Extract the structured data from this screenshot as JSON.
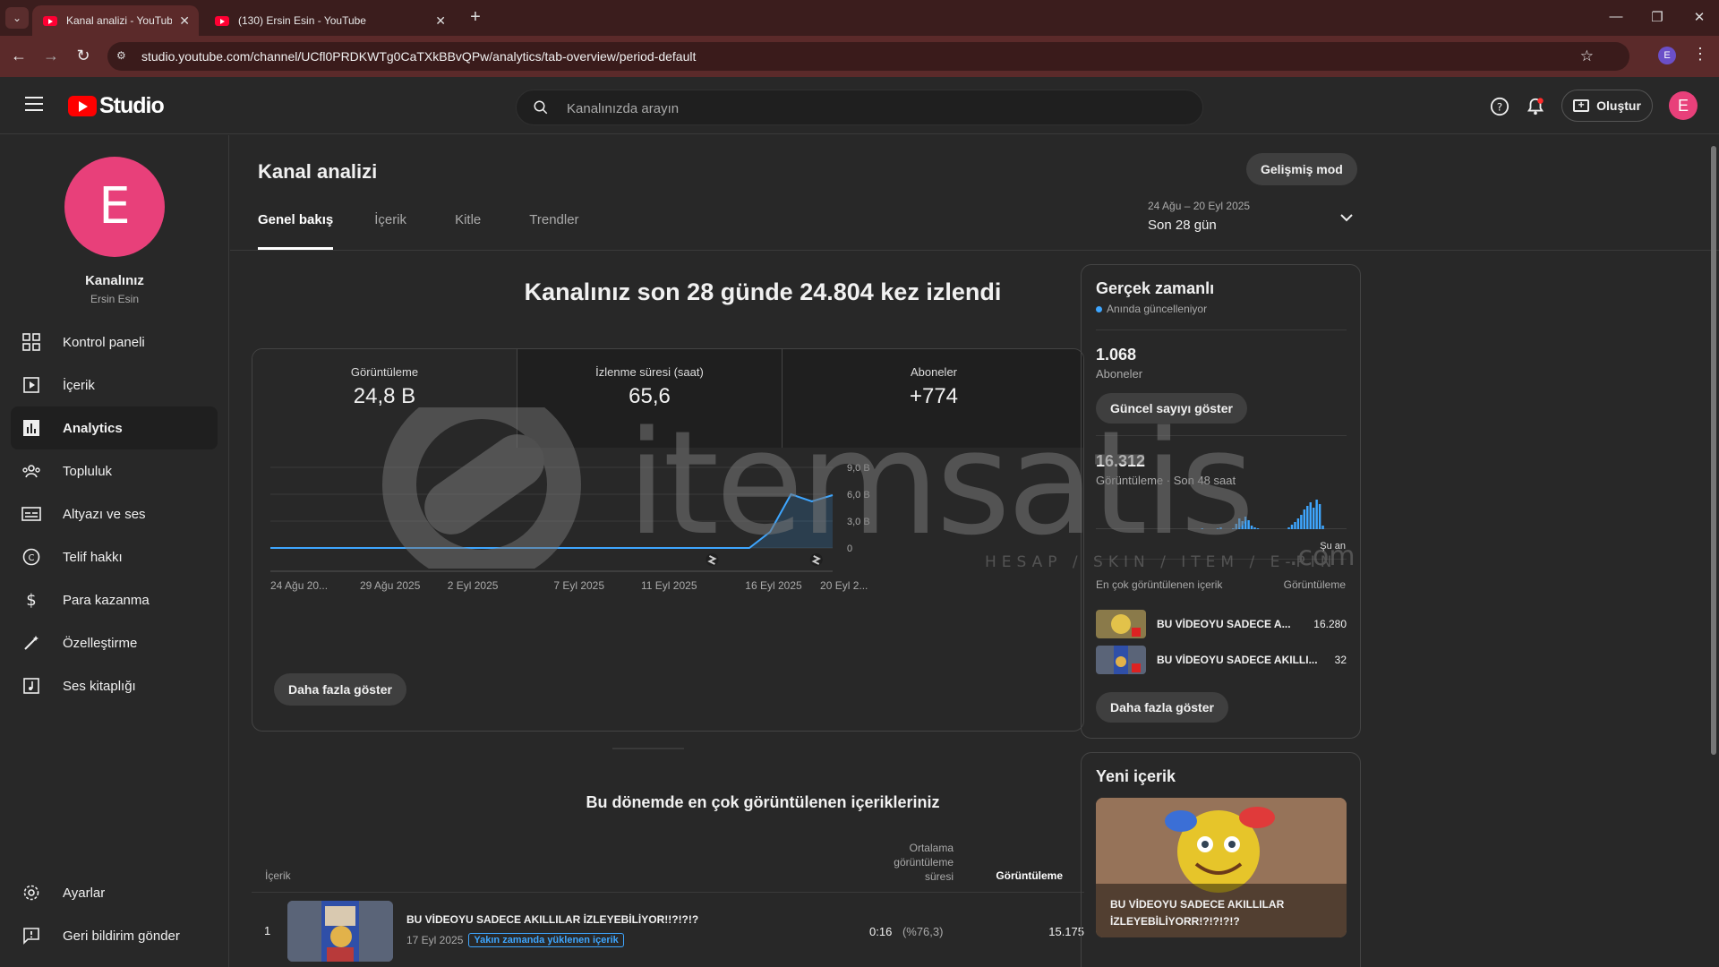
{
  "browser": {
    "tabs": [
      {
        "title": "Kanal analizi - YouTube Studio",
        "active": true
      },
      {
        "title": "(130) Ersin Esin - YouTube",
        "active": false
      }
    ],
    "url": "studio.youtube.com/channel/UCfl0PRDKWTg0CaTXkBBvQPw/analytics/tab-overview/period-default",
    "profile_initial": "E"
  },
  "header": {
    "logo_text": "Studio",
    "search_placeholder": "Kanalınızda arayın",
    "create_label": "Oluştur",
    "avatar_initial": "E"
  },
  "sidebar": {
    "avatar_initial": "E",
    "channel_label": "Kanalınız",
    "channel_name": "Ersin Esin",
    "items": [
      {
        "label": "Kontrol paneli",
        "icon": "dashboard-icon"
      },
      {
        "label": "İçerik",
        "icon": "content-icon"
      },
      {
        "label": "Analytics",
        "icon": "analytics-icon",
        "active": true
      },
      {
        "label": "Topluluk",
        "icon": "community-icon"
      },
      {
        "label": "Altyazı ve ses",
        "icon": "subtitles-icon"
      },
      {
        "label": "Telif hakkı",
        "icon": "copyright-icon"
      },
      {
        "label": "Para kazanma",
        "icon": "monetization-icon"
      },
      {
        "label": "Özelleştirme",
        "icon": "customization-icon"
      },
      {
        "label": "Ses kitaplığı",
        "icon": "audio-library-icon"
      }
    ],
    "bottom": [
      {
        "label": "Ayarlar",
        "icon": "settings-icon"
      },
      {
        "label": "Geri bildirim gönder",
        "icon": "feedback-icon"
      }
    ]
  },
  "main": {
    "title": "Kanal analizi",
    "advanced_mode": "Gelişmiş mod",
    "tabs": [
      "Genel bakış",
      "İçerik",
      "Kitle",
      "Trendler"
    ],
    "period_range": "24 Ağu – 20 Eyl 2025",
    "period_label": "Son 28 gün",
    "headline": "Kanalınız son 28 günde 24.804 kez izlendi",
    "metrics": [
      {
        "label": "Görüntüleme",
        "value": "24,8 B"
      },
      {
        "label": "İzlenme süresi (saat)",
        "value": "65,6"
      },
      {
        "label": "Aboneler",
        "value": "+774"
      }
    ],
    "show_more": "Daha fazla göster",
    "top_content_title": "Bu dönemde en çok görüntülenen içerikleriniz",
    "table": {
      "col_content": "İçerik",
      "col_avg_line1": "Ortalama",
      "col_avg_line2": "görüntüleme",
      "col_avg_line3": "süresi",
      "col_views": "Görüntüleme",
      "rows": [
        {
          "rank": "1",
          "title": "BU VİDEOYU SADECE AKILLILAR İZLEYEBİLİYOR!!?!?!?",
          "date": "17 Eyl 2025",
          "badge": "Yakın zamanda yüklenen içerik",
          "avg": "0:16",
          "avg_pct": "(%76,3)",
          "views": "15.175"
        }
      ]
    }
  },
  "chart_data": {
    "type": "area",
    "x_tick_labels": [
      "24 Ağu 20...",
      "29 Ağu 2025",
      "2 Eyl 2025",
      "7 Eyl 2025",
      "11 Eyl 2025",
      "16 Eyl 2025",
      "20 Eyl 2..."
    ],
    "y_tick_labels": [
      "0",
      "3,0 B",
      "6,0 B",
      "9,0 B"
    ],
    "ylim": [
      0,
      9000
    ],
    "series": [
      {
        "values": [
          0,
          0,
          0,
          0,
          0,
          0,
          0,
          0,
          0,
          0,
          0,
          0,
          0,
          0,
          0,
          0,
          0,
          0,
          0,
          0,
          0,
          0,
          0,
          0,
          1800,
          6000,
          5200,
          5900
        ]
      }
    ],
    "color": "#3ea6ff"
  },
  "realtime": {
    "title": "Gerçek zamanlı",
    "subtitle": "Anında güncelleniyor",
    "subs_value": "1.068",
    "subs_label": "Aboneler",
    "live_count_btn": "Güncel sayıyı göster",
    "views_value": "16.312",
    "views_label": "Görüntüleme · Son 48 saat",
    "now_label": "Şu an",
    "top_label": "En çok görüntülenen içerik",
    "views_col": "Görüntüleme",
    "items": [
      {
        "title": "BU VİDEOYU SADECE A...",
        "views": "16.280"
      },
      {
        "title": "BU VİDEOYU SADECE AKILLI...",
        "views": "32"
      }
    ],
    "show_more": "Daha fazla göster"
  },
  "new_content": {
    "title": "Yeni içerik",
    "video_title_line1": "BU VİDEOYU SADECE AKILLILAR",
    "video_title_line2": "İZLEYEBİLİYORR!?!?!?!?"
  },
  "watermark": {
    "brand": "itemsatis",
    "tagline": "HESAP / SKIN / ITEM / E-PIN",
    "domain": ".com"
  }
}
